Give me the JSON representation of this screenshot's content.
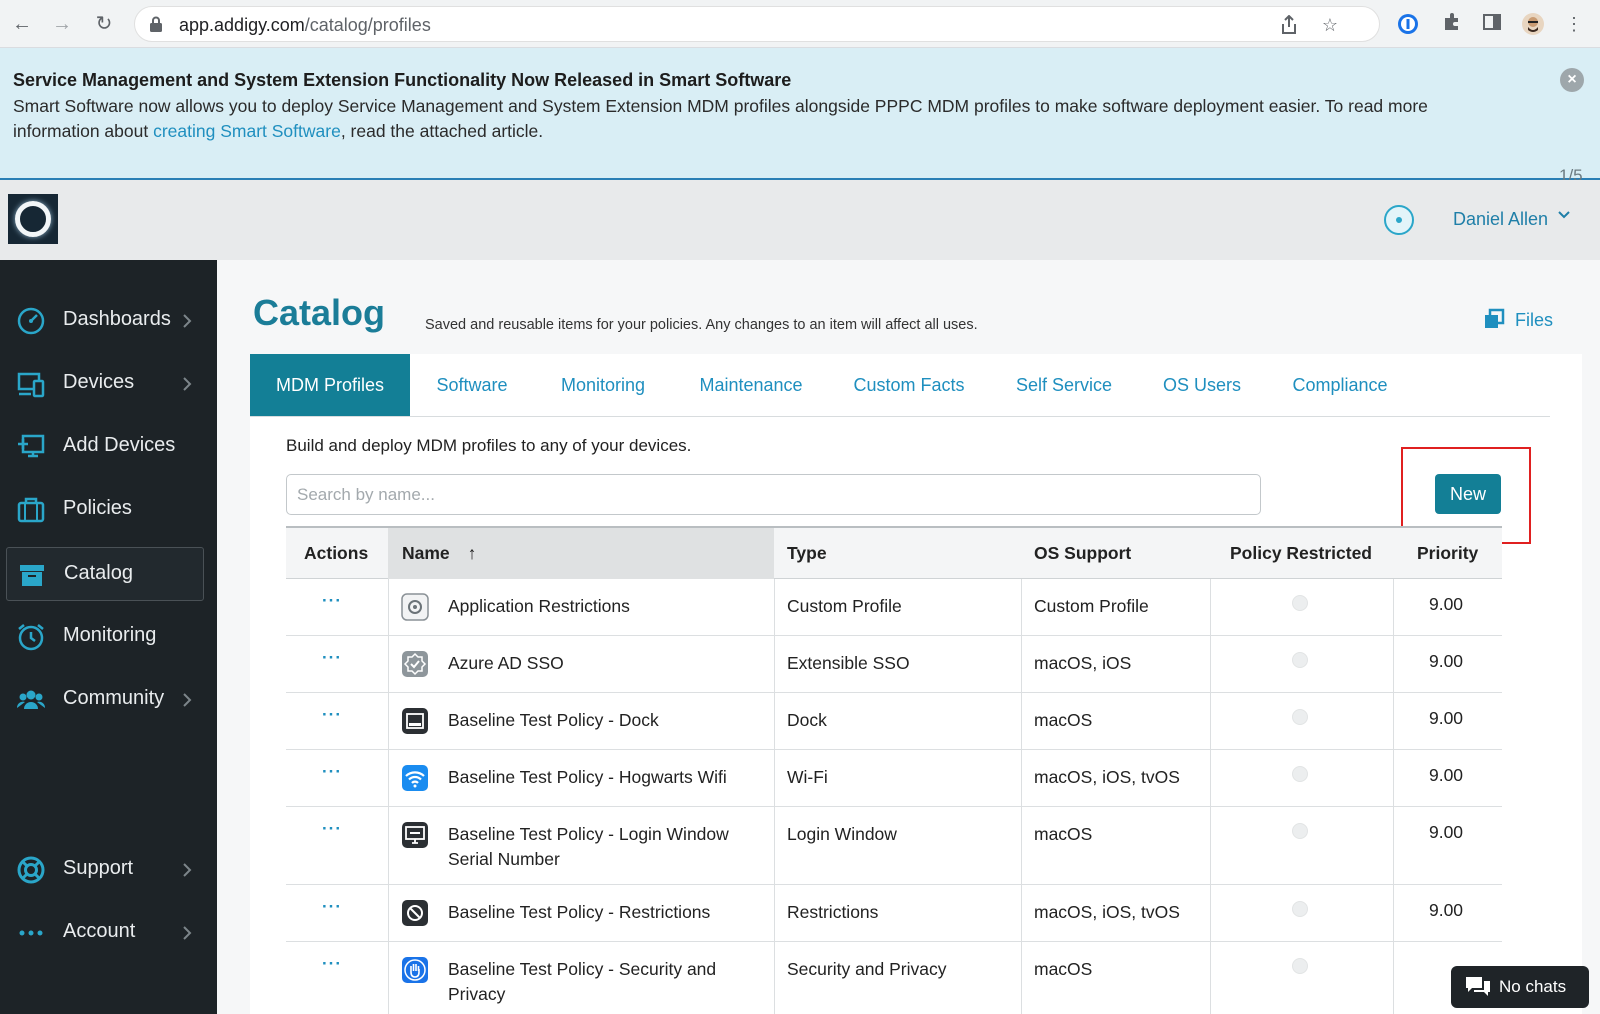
{
  "browser": {
    "url_host": "app.addigy.com",
    "url_path": "/catalog/profiles"
  },
  "banner": {
    "title": "Service Management and System Extension Functionality Now Released in Smart Software",
    "body_before": "Smart Software now allows you to deploy Service Management and System Extension MDM profiles alongside PPPC MDM profiles to make software deployment easier. To read more information about ",
    "link": "creating Smart Software",
    "body_after": ", read the attached article.",
    "counter": "1/5"
  },
  "header": {
    "user_name": "Daniel Allen"
  },
  "sidebar": {
    "items": [
      {
        "label": "Dashboards",
        "icon": "speedometer-icon"
      },
      {
        "label": "Devices",
        "icon": "devices-icon"
      },
      {
        "label": "Add Devices",
        "icon": "add-device-icon"
      },
      {
        "label": "Policies",
        "icon": "briefcase-icon"
      },
      {
        "label": "Catalog",
        "icon": "archive-box-icon"
      },
      {
        "label": "Monitoring",
        "icon": "alarm-clock-icon"
      },
      {
        "label": "Community",
        "icon": "people-icon"
      },
      {
        "label": "Support",
        "icon": "lifebuoy-icon"
      },
      {
        "label": "Account",
        "icon": "ellipsis-icon"
      }
    ]
  },
  "page": {
    "title": "Catalog",
    "subtitle": "Saved and reusable items for your policies. Any changes to an item will affect all uses.",
    "files_label": "Files"
  },
  "tabs": [
    "MDM Profiles",
    "Software",
    "Monitoring",
    "Maintenance",
    "Custom Facts",
    "Self Service",
    "OS Users",
    "Compliance"
  ],
  "panel": {
    "description": "Build and deploy MDM profiles to any of your devices.",
    "search_placeholder": "Search by name...",
    "new_button": "New"
  },
  "table": {
    "headers": {
      "actions": "Actions",
      "name": "Name",
      "sort_arrow": "↑",
      "type": "Type",
      "os": "OS Support",
      "restricted": "Policy Restricted",
      "priority": "Priority"
    },
    "rows": [
      {
        "actions": "···",
        "name": "Application Restrictions",
        "type": "Custom Profile",
        "os": "Custom Profile",
        "priority": "9.00",
        "icon": "gear-badge-icon"
      },
      {
        "actions": "···",
        "name": "Azure AD SSO",
        "type": "Extensible SSO",
        "os": "macOS, iOS",
        "priority": "9.00",
        "icon": "verified-badge-icon"
      },
      {
        "actions": "···",
        "name": "Baseline Test Policy - Dock",
        "type": "Dock",
        "os": "macOS",
        "priority": "9.00",
        "icon": "dock-icon"
      },
      {
        "actions": "···",
        "name": "Baseline Test Policy - Hogwarts Wifi",
        "type": "Wi-Fi",
        "os": "macOS, iOS, tvOS",
        "priority": "9.00",
        "icon": "wifi-icon"
      },
      {
        "actions": "···",
        "name": "Baseline Test Policy - Login Window Serial Number",
        "type": "Login Window",
        "os": "macOS",
        "priority": "9.00",
        "icon": "login-window-icon"
      },
      {
        "actions": "···",
        "name": "Baseline Test Policy - Restrictions",
        "type": "Restrictions",
        "os": "macOS, iOS, tvOS",
        "priority": "9.00",
        "icon": "restrictions-icon"
      },
      {
        "actions": "···",
        "name": "Baseline Test Policy - Security and Privacy",
        "type": "Security and Privacy",
        "os": "macOS",
        "priority": "",
        "icon": "hand-icon"
      }
    ]
  },
  "chat": {
    "label": "No chats"
  },
  "colors": {
    "accent": "#137f96",
    "link": "#1f8fbf",
    "sidebar_bg": "#1d2327",
    "banner_bg": "#d9eef5",
    "highlight": "#e02020"
  }
}
